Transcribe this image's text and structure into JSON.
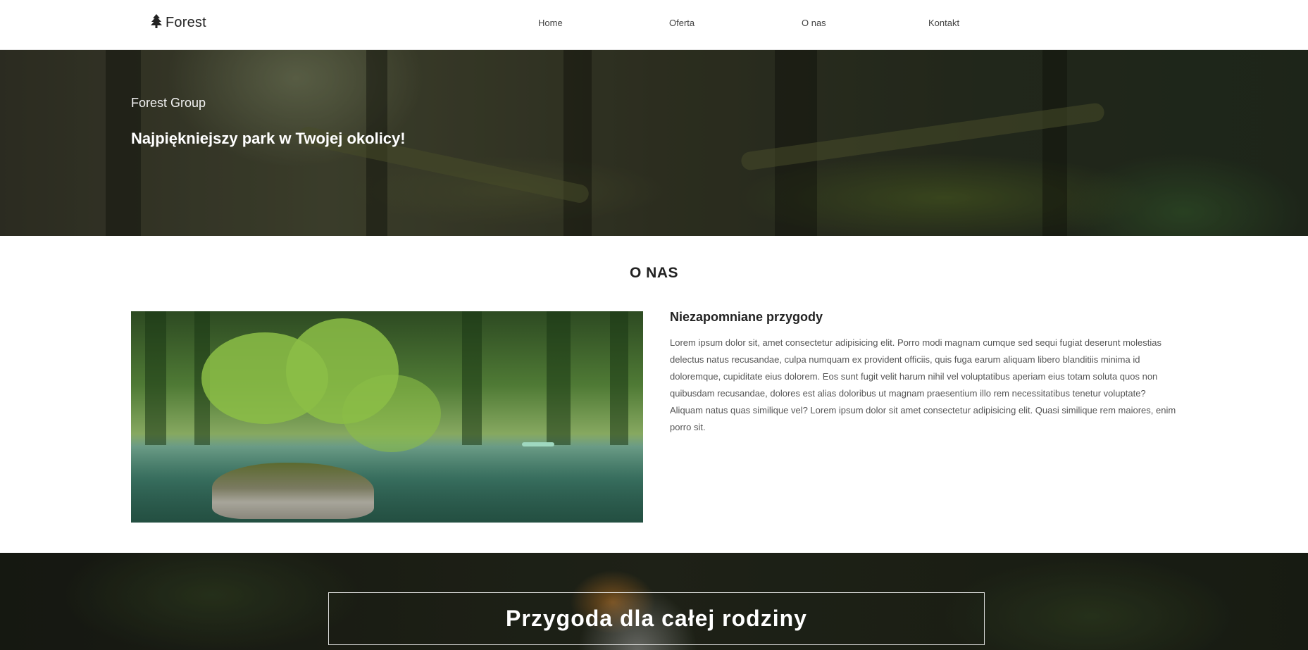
{
  "brand": {
    "name": "Forest",
    "icon": "tree-icon"
  },
  "nav": {
    "items": [
      {
        "label": "Home"
      },
      {
        "label": "Oferta"
      },
      {
        "label": "O nas"
      },
      {
        "label": "Kontakt"
      }
    ]
  },
  "hero": {
    "subtitle": "Forest Group",
    "title": "Najpiękniejszy park w Twojej okolicy!"
  },
  "about": {
    "section_title": "O NAS",
    "heading": "Niezapomniane przygody",
    "text": "Lorem ipsum dolor sit, amet consectetur adipisicing elit. Porro modi magnam cumque sed sequi fugiat deserunt molestias delectus natus recusandae, culpa numquam ex provident officiis, quis fuga earum aliquam libero blanditiis minima id doloremque, cupiditate eius dolorem. Eos sunt fugit velit harum nihil vel voluptatibus aperiam eius totam soluta quos non quibusdam recusandae, dolores est alias doloribus ut magnam praesentium illo rem necessitatibus tenetur voluptate? Aliquam natus quas similique vel? Lorem ipsum dolor sit amet consectetur adipisicing elit. Quasi similique rem maiores, enim porro sit."
  },
  "banner": {
    "title": "Przygoda dla całej rodziny"
  }
}
